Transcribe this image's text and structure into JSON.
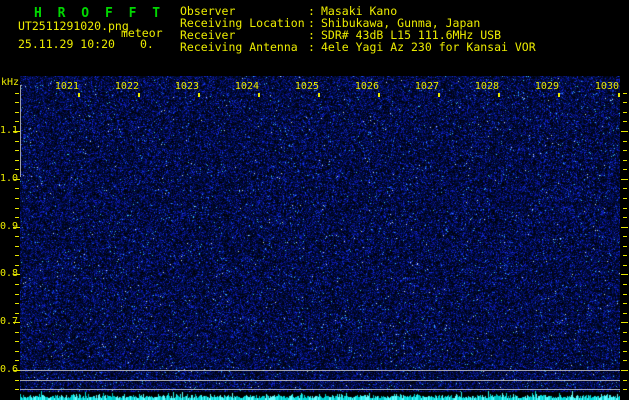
{
  "header": {
    "title": "H R O F F T",
    "filename": "UT2511291020.png",
    "overlay_label": "meteor",
    "datetime": "25.11.29 10:20",
    "echo_count": "0.",
    "colon": ":",
    "info": [
      {
        "label": "Observer",
        "value": "Masaki Kano"
      },
      {
        "label": "Receiving Location",
        "value": "Shibukawa, Gunma, Japan"
      },
      {
        "label": "Receiver",
        "value": "SDR# 43dB L15 111.6MHz USB"
      },
      {
        "label": "Receiving Antenna",
        "value": "4ele Yagi Az 230 for Kansai VOR"
      }
    ]
  },
  "chart_data": {
    "type": "heatmap",
    "title": "HROFFT 10-minute radio meteor observation spectrogram",
    "ylabel": "kHz",
    "ytick_labels": [
      "1.1",
      "1.0",
      "0.9",
      "0.8",
      "0.7",
      "0.6"
    ],
    "ylim": [
      0.55,
      1.21
    ],
    "xtick_labels": [
      "1021",
      "1022",
      "1023",
      "1024",
      "1025",
      "1026",
      "1027",
      "1028",
      "1029",
      "1030"
    ],
    "x_range_hhmm": [
      "10:20",
      "10:30"
    ],
    "grid": false,
    "reference_lines_khz": [
      0.6,
      0.58,
      0.56
    ],
    "content": "uniform dark-blue background noise across entire band; no meteor echo traces visible",
    "meteor_echo_count": "0.",
    "bottom_strip": "cyan noise-level bargraph along full time axis"
  },
  "colors": {
    "background": "#000000",
    "title_green": "#00d800",
    "text_yellow": "#ecec00",
    "noise_blue": "#0000a0",
    "signal_cyan": "#00e0e0",
    "reference_gray": "#cdcdcd"
  }
}
